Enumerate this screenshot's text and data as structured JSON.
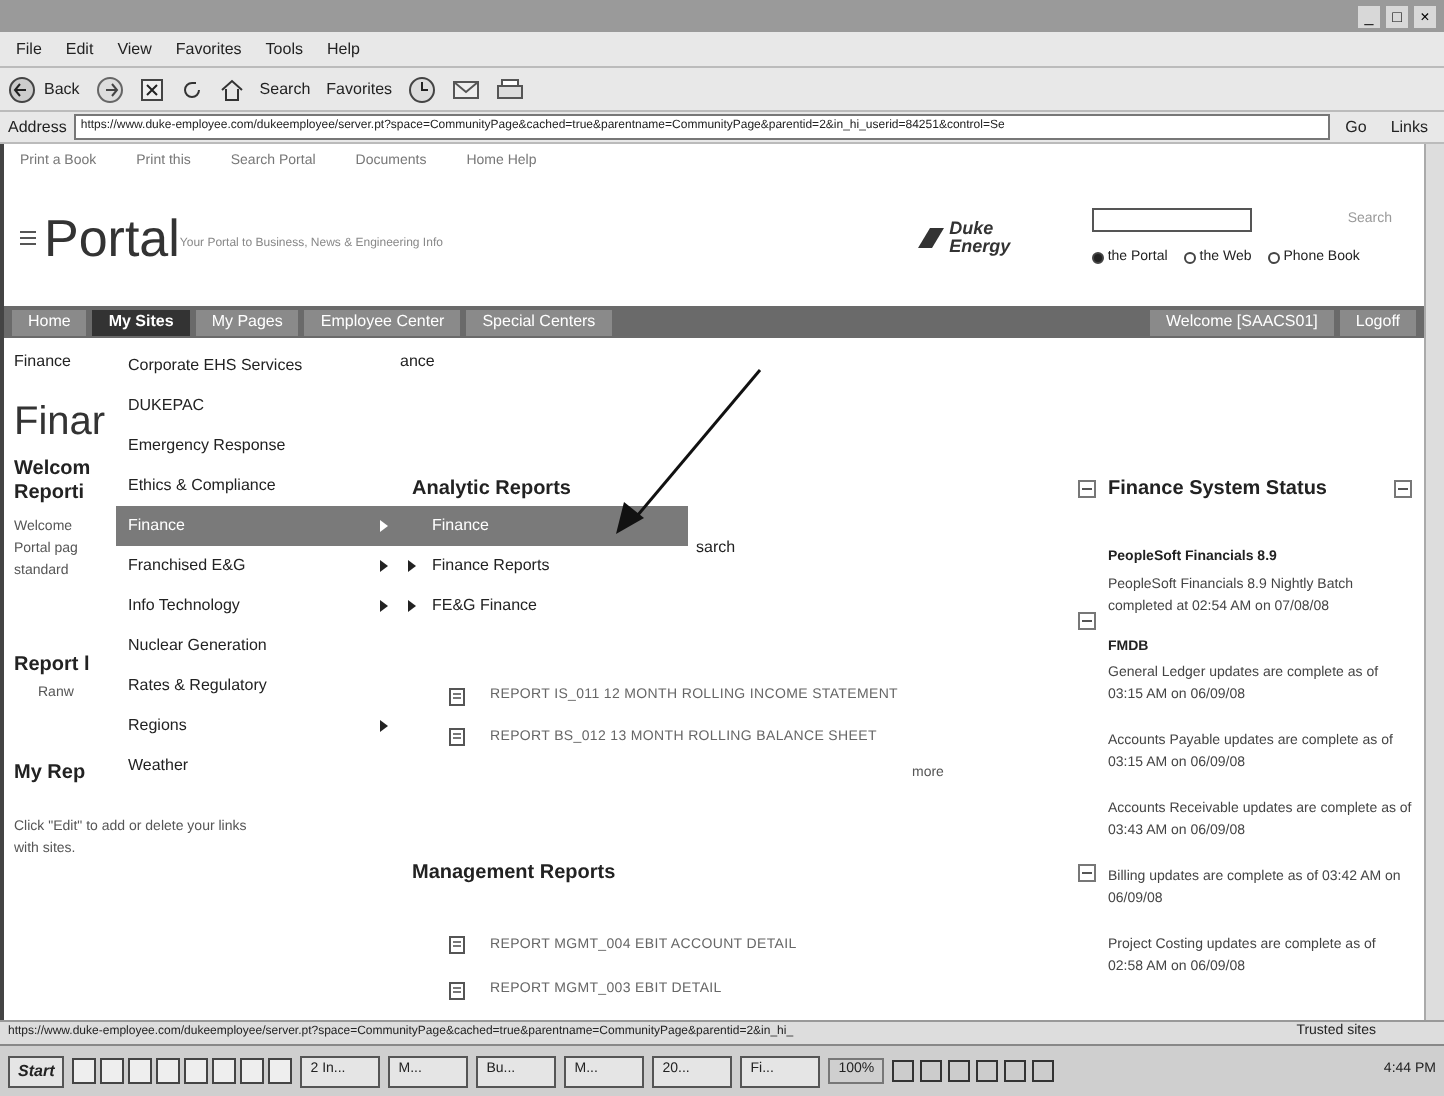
{
  "window": {
    "controls": [
      "_",
      "□",
      "×"
    ]
  },
  "menu_bar": [
    "File",
    "Edit",
    "View",
    "Favorites",
    "Tools",
    "Help"
  ],
  "toolbar": {
    "back": "Back",
    "search": "Search",
    "favorites": "Favorites"
  },
  "address": {
    "label": "Address",
    "url": "https://www.duke-employee.com/dukeemployee/server.pt?space=CommunityPage&cached=true&parentname=CommunityPage&parentid=2&in_hi_userid=84251&control=Se",
    "go": "Go",
    "links": "Links"
  },
  "links_bar": [
    "Print a Book",
    "Print this",
    "Search Portal",
    "Documents",
    "Home Help"
  ],
  "portal": {
    "title": "Portal",
    "tagline": "Your Portal to Business, News & Engineering Info",
    "logo_line_1": "Duke",
    "logo_line_2": "Energy",
    "search_button": "Search",
    "scopes": [
      {
        "label": "the Portal",
        "selected": true
      },
      {
        "label": "the Web",
        "selected": false
      },
      {
        "label": "Phone Book",
        "selected": false
      }
    ]
  },
  "nav": {
    "tabs": [
      {
        "label": "Home",
        "selected": false
      },
      {
        "label": "My Sites",
        "selected": true
      },
      {
        "label": "My Pages",
        "selected": false
      },
      {
        "label": "Employee Center",
        "selected": false
      },
      {
        "label": "Special Centers",
        "selected": false
      }
    ],
    "welcome": "Welcome [SAACS01]",
    "logoff": "Logoff"
  },
  "left": {
    "breadcrumb": "Finance",
    "title": "Finar",
    "welcome_heading": [
      "Welcom",
      "Reporti"
    ],
    "welcome_text": [
      "Welcome",
      "Portal pag",
      "standard"
    ],
    "report_heading": "Report l",
    "report_text": "Ranw",
    "my_reports_heading": "My Rep",
    "my_reports_text": "Click \"Edit\" to add or delete your links with sites."
  },
  "sites_menu": [
    {
      "label": "Corporate EHS Services",
      "selected": false,
      "submenu": false
    },
    {
      "label": "DUKEPAC",
      "selected": false,
      "submenu": false
    },
    {
      "label": "Emergency Response",
      "selected": false,
      "submenu": false
    },
    {
      "label": "Ethics & Compliance",
      "selected": false,
      "submenu": false
    },
    {
      "label": "Finance",
      "selected": true,
      "submenu": true
    },
    {
      "label": "Franchised E&G",
      "selected": false,
      "submenu": true
    },
    {
      "label": "Info Technology",
      "selected": false,
      "submenu": true
    },
    {
      "label": "Nuclear Generation",
      "selected": false,
      "submenu": false
    },
    {
      "label": "Rates & Regulatory",
      "selected": false,
      "submenu": false
    },
    {
      "label": "Regions",
      "selected": false,
      "submenu": true
    },
    {
      "label": "Weather",
      "selected": false,
      "submenu": false
    }
  ],
  "finance_submenu": [
    {
      "label": "Finance",
      "selected": true,
      "submenu": false
    },
    {
      "label": "Finance Reports",
      "selected": false,
      "submenu": true
    },
    {
      "label": "FE&G Finance",
      "selected": false,
      "submenu": true
    }
  ],
  "center": {
    "breadcrumb_rest": "ance",
    "analytic_heading": "Analytic Reports",
    "hidden_text": "sarch",
    "analytic_reports": [
      "REPORT IS_011 12 MONTH ROLLING INCOME STATEMENT",
      "REPORT BS_012 13 MONTH ROLLING BALANCE SHEET"
    ],
    "more": "more",
    "management_heading": "Management Reports",
    "management_reports": [
      "REPORT MGMT_004 EBIT ACCOUNT DETAIL",
      "REPORT MGMT_003 EBIT DETAIL"
    ]
  },
  "status_panel": {
    "title": "Finance System Status",
    "system": "PeopleSoft Financials 8.9",
    "entries": [
      {
        "text": "PeopleSoft Financials 8.9 Nightly Batch completed at 02:54 AM on 07/08/08"
      },
      {
        "heading": "FMDB",
        "text": "General Ledger updates are complete as of 03:15 AM on 06/09/08"
      },
      {
        "text": "Accounts Payable updates are complete as of 03:15 AM on 06/09/08"
      },
      {
        "text": "Accounts Receivable updates are complete as of 03:43 AM on 06/09/08"
      },
      {
        "text": "Billing updates are complete as of 03:42 AM on 06/09/08"
      },
      {
        "text": "Project Costing updates are complete as of 02:58 AM on 06/09/08"
      }
    ]
  },
  "status_bar": {
    "url": "https://www.duke-employee.com/dukeemployee/server.pt?space=CommunityPage&cached=true&parentname=CommunityPage&parentid=2&in_hi_",
    "zone": "Trusted sites"
  },
  "taskbar": {
    "start": "Start",
    "tasks": [
      "2 In...",
      "M...",
      "Bu...",
      "M...",
      "20...",
      "Fi..."
    ],
    "zoom": "100%",
    "clock": "4:44 PM"
  }
}
